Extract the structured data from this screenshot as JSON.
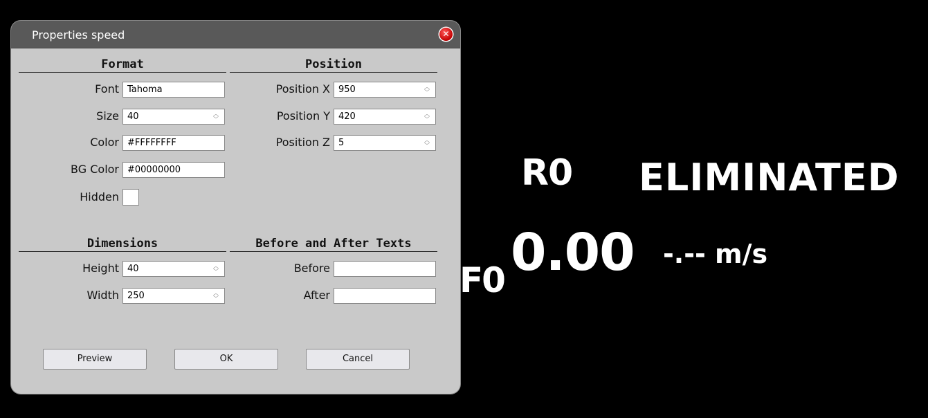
{
  "overlay": {
    "rank": "R0",
    "status": "ELIMINATED",
    "faults": "F0",
    "speed": "0.00",
    "speed_unit": "-.-- m/s"
  },
  "dialog": {
    "title": "Properties speed",
    "close_icon": "close-icon",
    "format": {
      "heading": "Format",
      "font_label": "Font",
      "font_value": "Tahoma",
      "size_label": "Size",
      "size_value": "40",
      "color_label": "Color",
      "color_value": "#FFFFFFFF",
      "bgcolor_label": "BG Color",
      "bgcolor_value": "#00000000",
      "hidden_label": "Hidden"
    },
    "position": {
      "heading": "Position",
      "x_label": "Position X",
      "x_value": "950",
      "y_label": "Position Y",
      "y_value": "420",
      "z_label": "Position Z",
      "z_value": "5"
    },
    "dimensions": {
      "heading": "Dimensions",
      "height_label": "Height",
      "height_value": "40",
      "width_label": "Width",
      "width_value": "250"
    },
    "texts": {
      "heading": "Before and After Texts",
      "before_label": "Before",
      "before_value": "",
      "after_label": "After",
      "after_value": ""
    },
    "buttons": {
      "preview": "Preview",
      "ok": "OK",
      "cancel": "Cancel"
    }
  }
}
